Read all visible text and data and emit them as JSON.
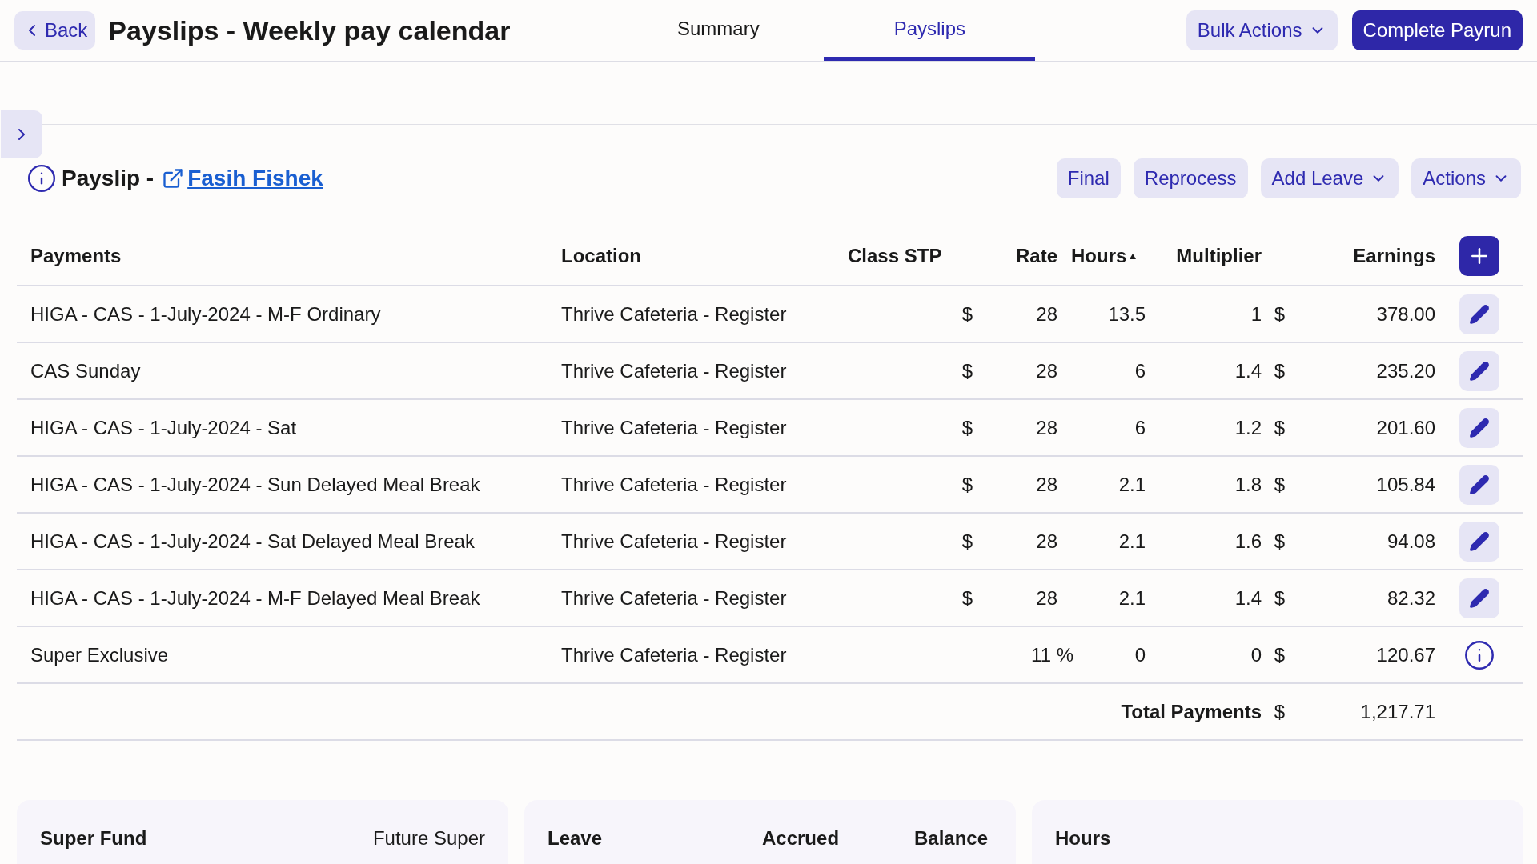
{
  "header": {
    "back": "Back",
    "title": "Payslips - Weekly pay calendar",
    "tabs": [
      {
        "label": "Summary",
        "selected": false
      },
      {
        "label": "Payslips",
        "selected": true
      }
    ],
    "buttons": [
      {
        "label": "Bulk Actions",
        "kind": "dropdown"
      },
      {
        "label": "Complete Payrun",
        "kind": "primary"
      }
    ]
  },
  "payslip": {
    "label": "Payslip -",
    "employee": "Fasih Fishek",
    "buttons": [
      {
        "label": "Final",
        "dropdown": false
      },
      {
        "label": "Reprocess",
        "dropdown": false
      },
      {
        "label": "Add Leave",
        "dropdown": true
      },
      {
        "label": "Actions",
        "dropdown": true
      }
    ]
  },
  "table": {
    "columns": [
      "Payments",
      "Location",
      "Class STP",
      "Rate",
      "Hours",
      "Multiplier",
      "Earnings"
    ],
    "rows": [
      {
        "kind": "payment",
        "payment": "HIGA - CAS - 1-July-2024 - M-F Ordinary",
        "location": "Thrive Cafeteria - Register",
        "rate_prefix": "$",
        "rate": "28",
        "hours": "13.5",
        "multiplier": "1",
        "earnings_prefix": "$",
        "earnings": "378.00"
      },
      {
        "kind": "payment",
        "payment": "CAS Sunday",
        "location": "Thrive Cafeteria - Register",
        "rate_prefix": "$",
        "rate": "28",
        "hours": "6",
        "multiplier": "1.4",
        "earnings_prefix": "$",
        "earnings": "235.20"
      },
      {
        "kind": "payment",
        "payment": "HIGA - CAS - 1-July-2024 - Sat",
        "location": "Thrive Cafeteria - Register",
        "rate_prefix": "$",
        "rate": "28",
        "hours": "6",
        "multiplier": "1.2",
        "earnings_prefix": "$",
        "earnings": "201.60"
      },
      {
        "kind": "payment",
        "payment": "HIGA - CAS - 1-July-2024 - Sun Delayed Meal Break",
        "location": "Thrive Cafeteria - Register",
        "rate_prefix": "$",
        "rate": "28",
        "hours": "2.1",
        "multiplier": "1.8",
        "earnings_prefix": "$",
        "earnings": "105.84"
      },
      {
        "kind": "payment",
        "payment": "HIGA - CAS - 1-July-2024 - Sat Delayed Meal Break",
        "location": "Thrive Cafeteria - Register",
        "rate_prefix": "$",
        "rate": "28",
        "hours": "2.1",
        "multiplier": "1.6",
        "earnings_prefix": "$",
        "earnings": "94.08"
      },
      {
        "kind": "payment",
        "payment": "HIGA - CAS - 1-July-2024 - M-F Delayed Meal Break",
        "location": "Thrive Cafeteria - Register",
        "rate_prefix": "$",
        "rate": "28",
        "hours": "2.1",
        "multiplier": "1.4",
        "earnings_prefix": "$",
        "earnings": "82.32"
      },
      {
        "kind": "super",
        "payment": "Super Exclusive",
        "location": "Thrive Cafeteria - Register",
        "rate": "11 %",
        "hours": "0",
        "multiplier": "0",
        "earnings_prefix": "$",
        "earnings": "120.67"
      }
    ],
    "total": {
      "label": "Total Payments",
      "prefix": "$",
      "value": "1,217.71"
    }
  },
  "cards": [
    {
      "headings": [
        "Super Fund"
      ],
      "value": "Future Super"
    },
    {
      "headings": [
        "Leave",
        "Accrued",
        "Balance"
      ]
    },
    {
      "headings": [
        "Hours"
      ]
    }
  ]
}
